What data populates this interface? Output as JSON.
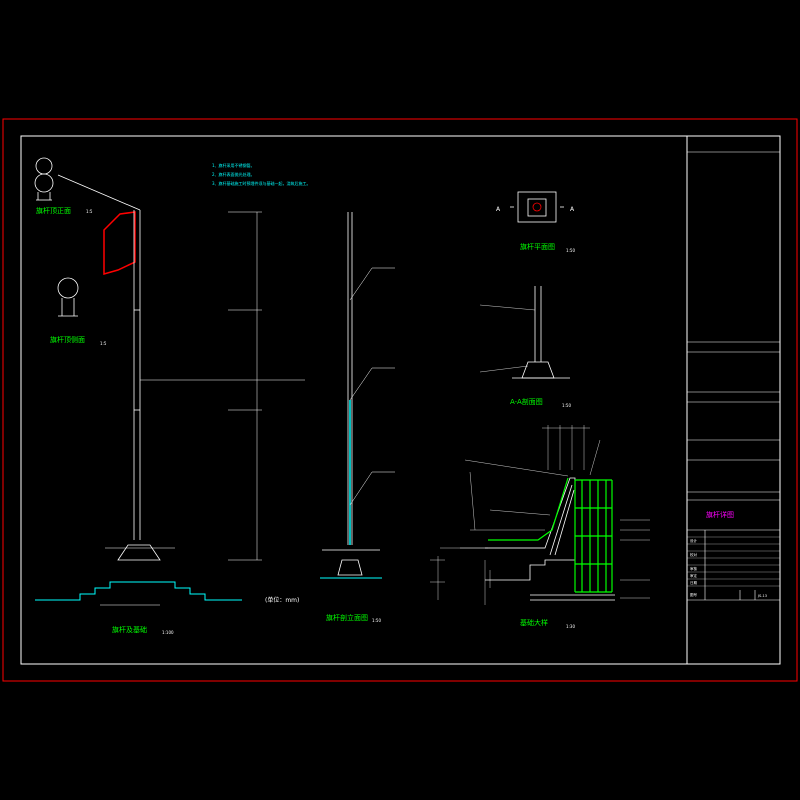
{
  "titles": {
    "flag_front": "旗杆顶正面",
    "flag_side": "旗杆顶侧面",
    "pole_foundation": "旗杆及基础",
    "pole_section": "旗杆剖立面图",
    "pole_plan": "旗杆平面图",
    "aa_section": "A-A剖面图",
    "detail": "基础大样"
  },
  "scales": {
    "flag_front": "1:5",
    "flag_side": "1:5",
    "pole_foundation": "1:100",
    "pole_section": "1:50",
    "pole_plan": "1:50",
    "aa_section": "1:50",
    "detail": "1:30"
  },
  "unit_note": "(单位：mm)",
  "section_marker": "A",
  "notes": [
    "1、旗杆采用不锈钢管。",
    "2、旗杆表面抛光处理。",
    "3、旗杆基础施工时预埋件须与基础一起，浇筑后施工。"
  ],
  "title_block": {
    "sheet_title": "旗杆详图",
    "rows": [
      "设计",
      "校对",
      "审核",
      "审定",
      "日期",
      "图号"
    ],
    "sheet_no": "JS-13"
  },
  "colors": {
    "border": "#ff0000",
    "frame": "#ffffff",
    "dim": "#00ffff",
    "text": "#00ff00",
    "flag": "#ff0000",
    "title_text": "#ff00ff",
    "note_text": "#00ffff"
  }
}
